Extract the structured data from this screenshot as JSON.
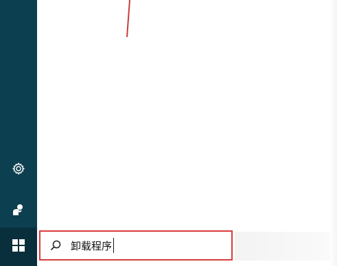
{
  "left_rail": {
    "settings_icon": "gear-icon",
    "user_icon": "user-icon",
    "start_icon": "windows-logo-icon"
  },
  "search": {
    "icon": "search-icon",
    "value": "卸载程序",
    "highlight_color": "#d93b3b"
  },
  "colors": {
    "rail": "#0c3f4f",
    "start_tile": "#0a2f3c",
    "annotation": "#c83c3c"
  }
}
